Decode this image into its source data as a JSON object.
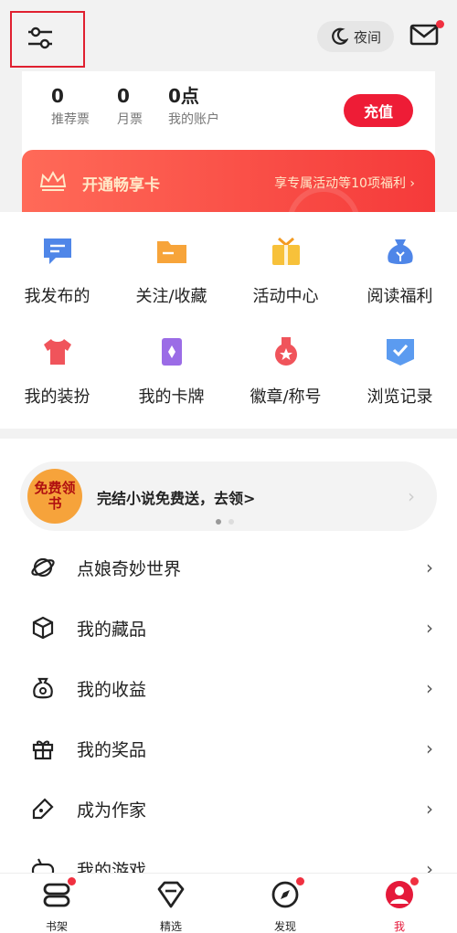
{
  "header": {
    "night_mode_label": "夜间"
  },
  "account": {
    "recommend_tickets": {
      "value": "0",
      "label": "推荐票"
    },
    "monthly_tickets": {
      "value": "0",
      "label": "月票"
    },
    "balance": {
      "value": "0点",
      "label": "我的账户"
    },
    "recharge_label": "充值"
  },
  "vip": {
    "title": "开通畅享卡",
    "benefit": "享专属活动等10项福利 ›"
  },
  "grid": [
    {
      "label": "我发布的",
      "icon": "chat-bubble-icon"
    },
    {
      "label": "关注/收藏",
      "icon": "folder-icon"
    },
    {
      "label": "活动中心",
      "icon": "gift-box-icon"
    },
    {
      "label": "阅读福利",
      "icon": "money-bag-icon"
    },
    {
      "label": "我的装扮",
      "icon": "tshirt-icon"
    },
    {
      "label": "我的卡牌",
      "icon": "card-icon"
    },
    {
      "label": "徽章/称号",
      "icon": "medal-icon"
    },
    {
      "label": "浏览记录",
      "icon": "history-icon"
    }
  ],
  "promo": {
    "badge": "免费领书",
    "text": "完结小说免费送，去领>"
  },
  "menu": [
    {
      "label": "点娘奇妙世界",
      "icon": "planet-icon"
    },
    {
      "label": "我的藏品",
      "icon": "cube-icon"
    },
    {
      "label": "我的收益",
      "icon": "coin-bag-icon"
    },
    {
      "label": "我的奖品",
      "icon": "gift-icon"
    },
    {
      "label": "成为作家",
      "icon": "pen-icon"
    },
    {
      "label": "我的游戏",
      "icon": "gamepad-icon"
    }
  ],
  "tabbar": [
    {
      "label": "书架",
      "icon": "bookshelf-icon",
      "badge": true
    },
    {
      "label": "精选",
      "icon": "diamond-icon",
      "badge": false
    },
    {
      "label": "发现",
      "icon": "compass-icon",
      "badge": true
    },
    {
      "label": "我",
      "icon": "profile-icon",
      "badge": true
    }
  ],
  "colors": {
    "accent": "#ee1c36",
    "vip_gradient_start": "#ff6a58",
    "vip_gradient_end": "#f53a3a"
  }
}
